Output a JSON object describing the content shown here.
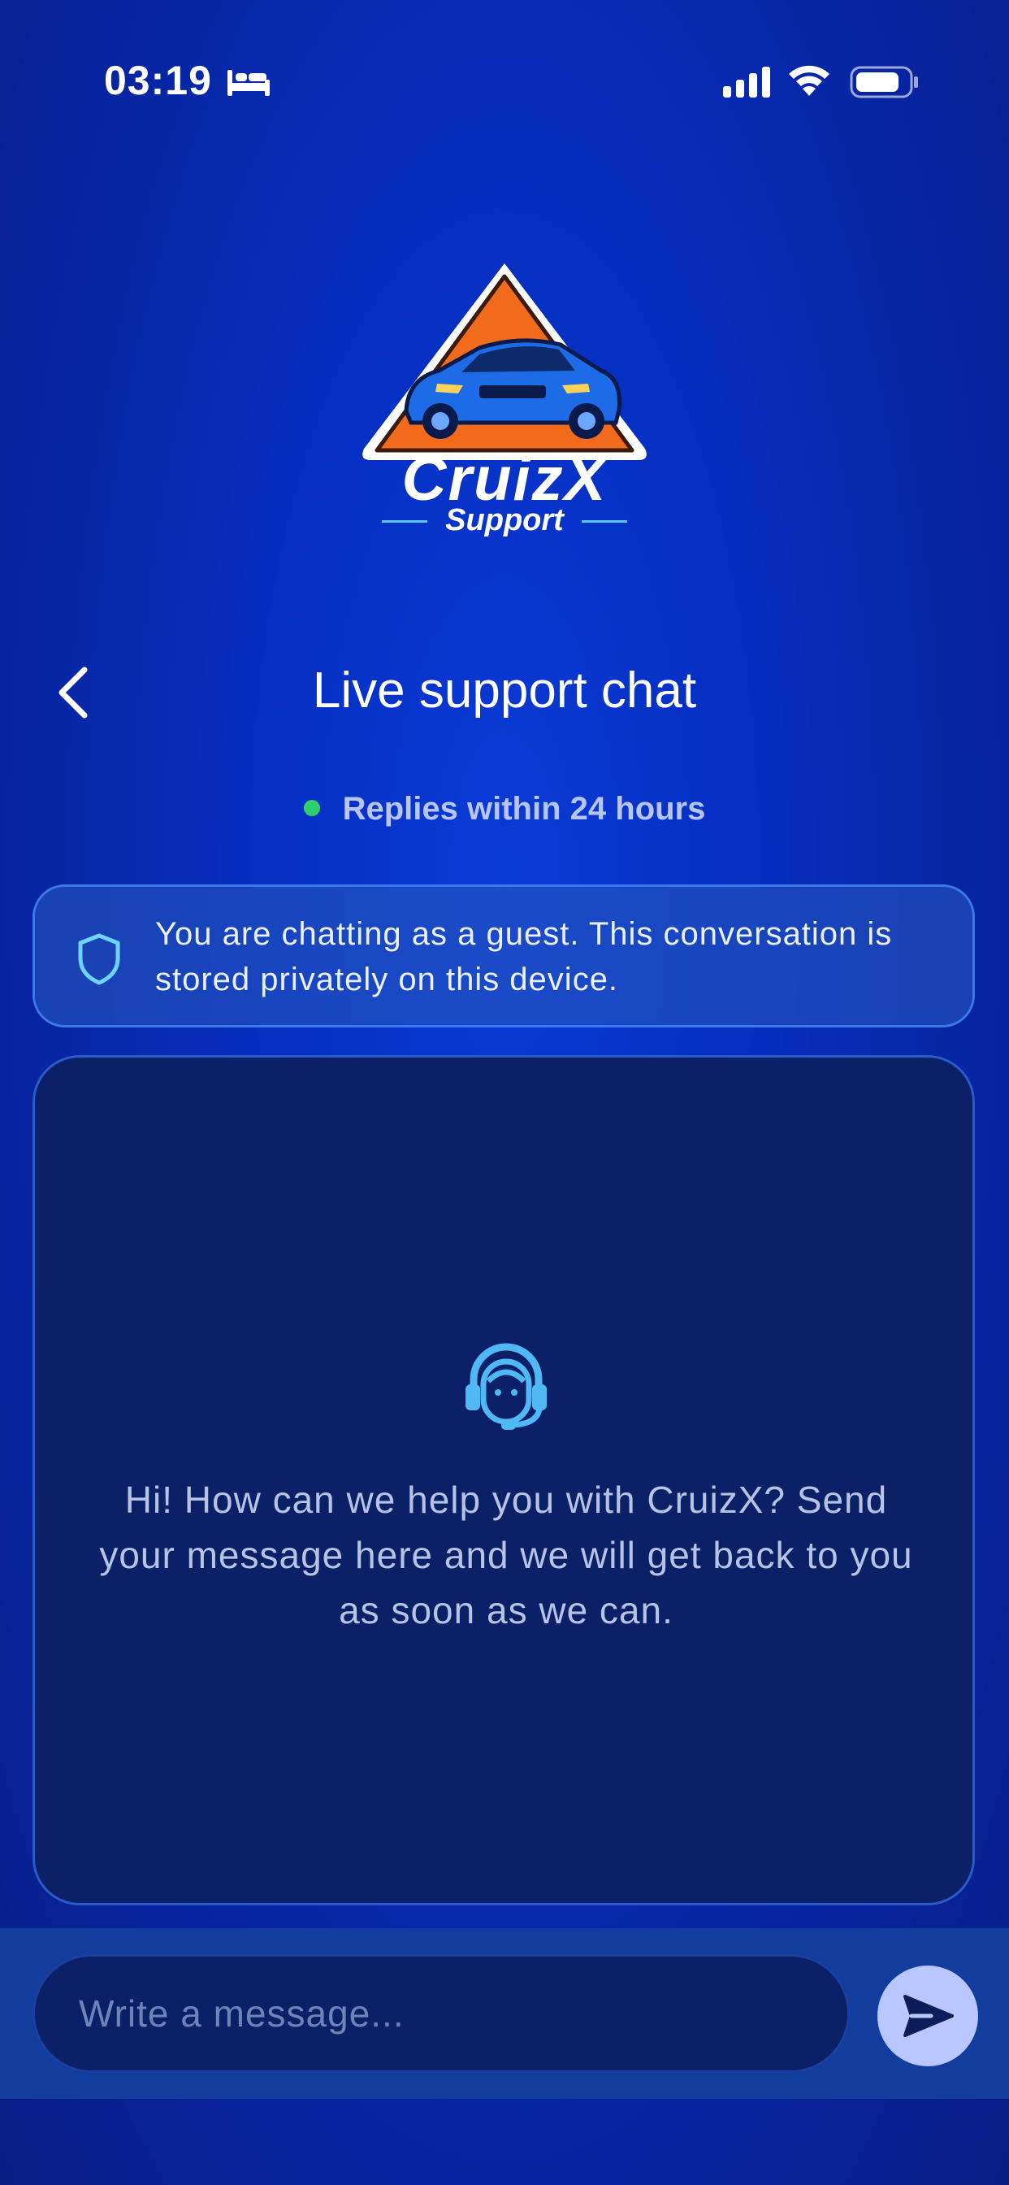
{
  "status_bar": {
    "time": "03:19",
    "icons": [
      "bed-icon",
      "signal-icon",
      "wifi-icon",
      "battery-icon"
    ]
  },
  "logo": {
    "wordmark": "CruizX",
    "subtitle": "Support"
  },
  "header": {
    "back_icon": "chevron-left-icon",
    "title": "Live support chat"
  },
  "availability": {
    "text": "Replies within 24 hours",
    "dot_color": "#2fd06b"
  },
  "guest_notice": {
    "icon": "shield-icon",
    "text": "You are chatting as a guest. This conversation is stored privately on this device."
  },
  "chat": {
    "icon": "support-agent-icon",
    "welcome": "Hi! How can we help you with CruizX? Send your message here and we will get back to you as soon as we can."
  },
  "composer": {
    "placeholder": "Write a message...",
    "send_icon": "send-icon"
  },
  "colors": {
    "background": "#0630c4",
    "accent": "#5fc7ff",
    "send_button": "#b9c6ff",
    "chat_panel": "#0b2066"
  }
}
